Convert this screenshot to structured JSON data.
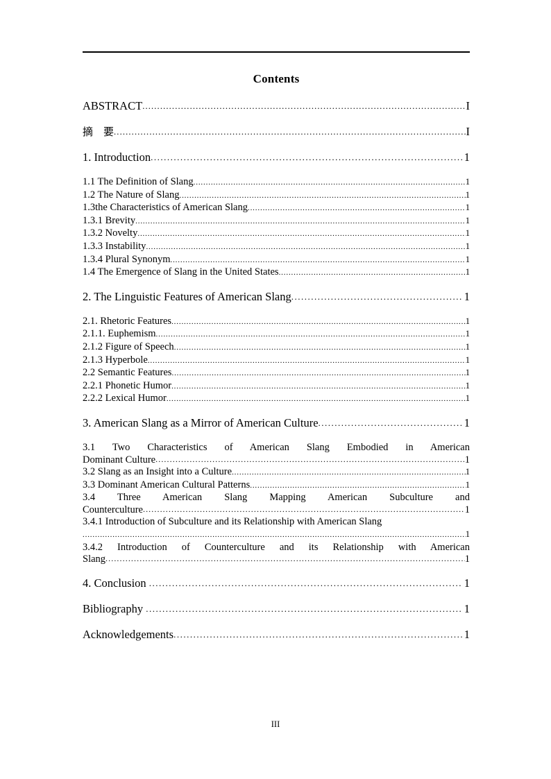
{
  "document": {
    "title": "Contents",
    "folio": "III"
  },
  "toc": {
    "front_matter": [
      {
        "label": "ABSTRACT",
        "page": "I"
      },
      {
        "label": "摘　要",
        "page": "I"
      }
    ],
    "chapter_1": {
      "heading": {
        "label": "1. Introduction",
        "page": "1"
      },
      "items": [
        {
          "label": "1.1 The Definition of Slang",
          "page": "1"
        },
        {
          "label": "1.2 The Nature of Slang",
          "page": "1"
        },
        {
          "label": "1.3the Characteristics of American Slang",
          "page": "1"
        },
        {
          "label": "1.3.1 Brevity",
          "page": "1"
        },
        {
          "label": "1.3.2 Novelty",
          "page": "1"
        },
        {
          "label": "1.3.3 Instability",
          "page": "1"
        },
        {
          "label": "1.3.4 Plural Synonym",
          "page": "1"
        },
        {
          "label": "1.4 The Emergence of Slang in the United States",
          "page": "1"
        }
      ]
    },
    "chapter_2": {
      "heading": {
        "label": "2. The Linguistic Features of American Slang",
        "page": "1"
      },
      "items": [
        {
          "label": "2.1. Rhetoric Features",
          "page": "1"
        },
        {
          "label": "2.1.1. Euphemism",
          "page": "1"
        },
        {
          "label": "2.1.2 Figure of Speech",
          "page": "1"
        },
        {
          "label": "2.1.3 Hyperbole",
          "page": "1"
        },
        {
          "label": "2.2 Semantic Features",
          "page": "1"
        },
        {
          "label": "2.2.1 Phonetic Humor",
          "page": "1"
        },
        {
          "label": "2.2.2 Lexical Humor",
          "page": "1"
        }
      ]
    },
    "chapter_3": {
      "heading": {
        "label": "3. American Slang as a Mirror of American Culture",
        "page": "1"
      },
      "item_3_1": {
        "line1": "3.1 Two Characteristics of American Slang Embodied in American",
        "line2": "Dominant Culture",
        "page": "1"
      },
      "item_3_2": {
        "label": "3.2 Slang as an Insight into a Culture",
        "page": "1"
      },
      "item_3_3": {
        "label": "3.3 Dominant American Cultural Patterns",
        "page": "1"
      },
      "item_3_4": {
        "line1": "3.4 Three American Slang Mapping American Subculture and",
        "line2": "Counterculture",
        "page": "1"
      },
      "item_3_4_1": {
        "line1": "3.4.1 Introduction of Subculture and its Relationship with American Slang",
        "page": "1"
      },
      "item_3_4_2": {
        "line1": "3.4.2 Introduction of Counterculture and its Relationship with American",
        "line2": "Slang",
        "page": "1"
      }
    },
    "chapter_4": {
      "heading": {
        "label": "4. Conclusion ",
        "page": "1"
      }
    },
    "back_matter": [
      {
        "label": "Bibliography ",
        "page": "1"
      },
      {
        "label": "Acknowledgements",
        "page": "1"
      }
    ]
  }
}
